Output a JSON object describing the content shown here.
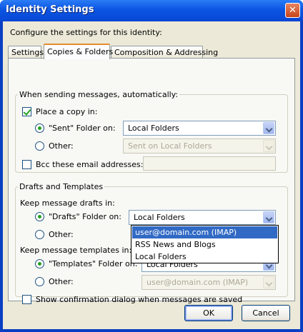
{
  "window": {
    "title": "Identity Settings",
    "close_glyph": "✕"
  },
  "intro": "Configure the settings for this identity:",
  "tabs": [
    {
      "label": "Settings"
    },
    {
      "label": "Copies & Folders"
    },
    {
      "label": "Composition & Addressing"
    }
  ],
  "sending": {
    "legend": "When sending messages, automatically:",
    "place_copy_label": "Place a copy in:",
    "sent_radio_label": "\"Sent\" Folder on:",
    "sent_combo_value": "Local Folders",
    "other_label": "Other:",
    "other_combo_value": "Sent on Local Folders",
    "bcc_label": "Bcc these email addresses:",
    "bcc_value": ""
  },
  "drafts": {
    "legend": "Drafts and Templates",
    "keep_drafts_label": "Keep message drafts in:",
    "drafts_radio_label": "\"Drafts\" Folder on:",
    "drafts_combo_value": "Local Folders",
    "drafts_other_label": "Other:",
    "keep_templates_label": "Keep message templates in:",
    "templates_radio_label": "\"Templates\" Folder on:",
    "templates_combo_value": "Local Folders",
    "templates_other_label": "Other:",
    "templates_other_value": "user@domain.com  (IMAP)",
    "confirm_label": "Show confirmation dialog when messages are saved"
  },
  "dropdown_options": [
    "user@domain.com  (IMAP)",
    "RSS News and Blogs",
    "Local Folders"
  ],
  "buttons": {
    "ok": "OK",
    "cancel": "Cancel"
  }
}
